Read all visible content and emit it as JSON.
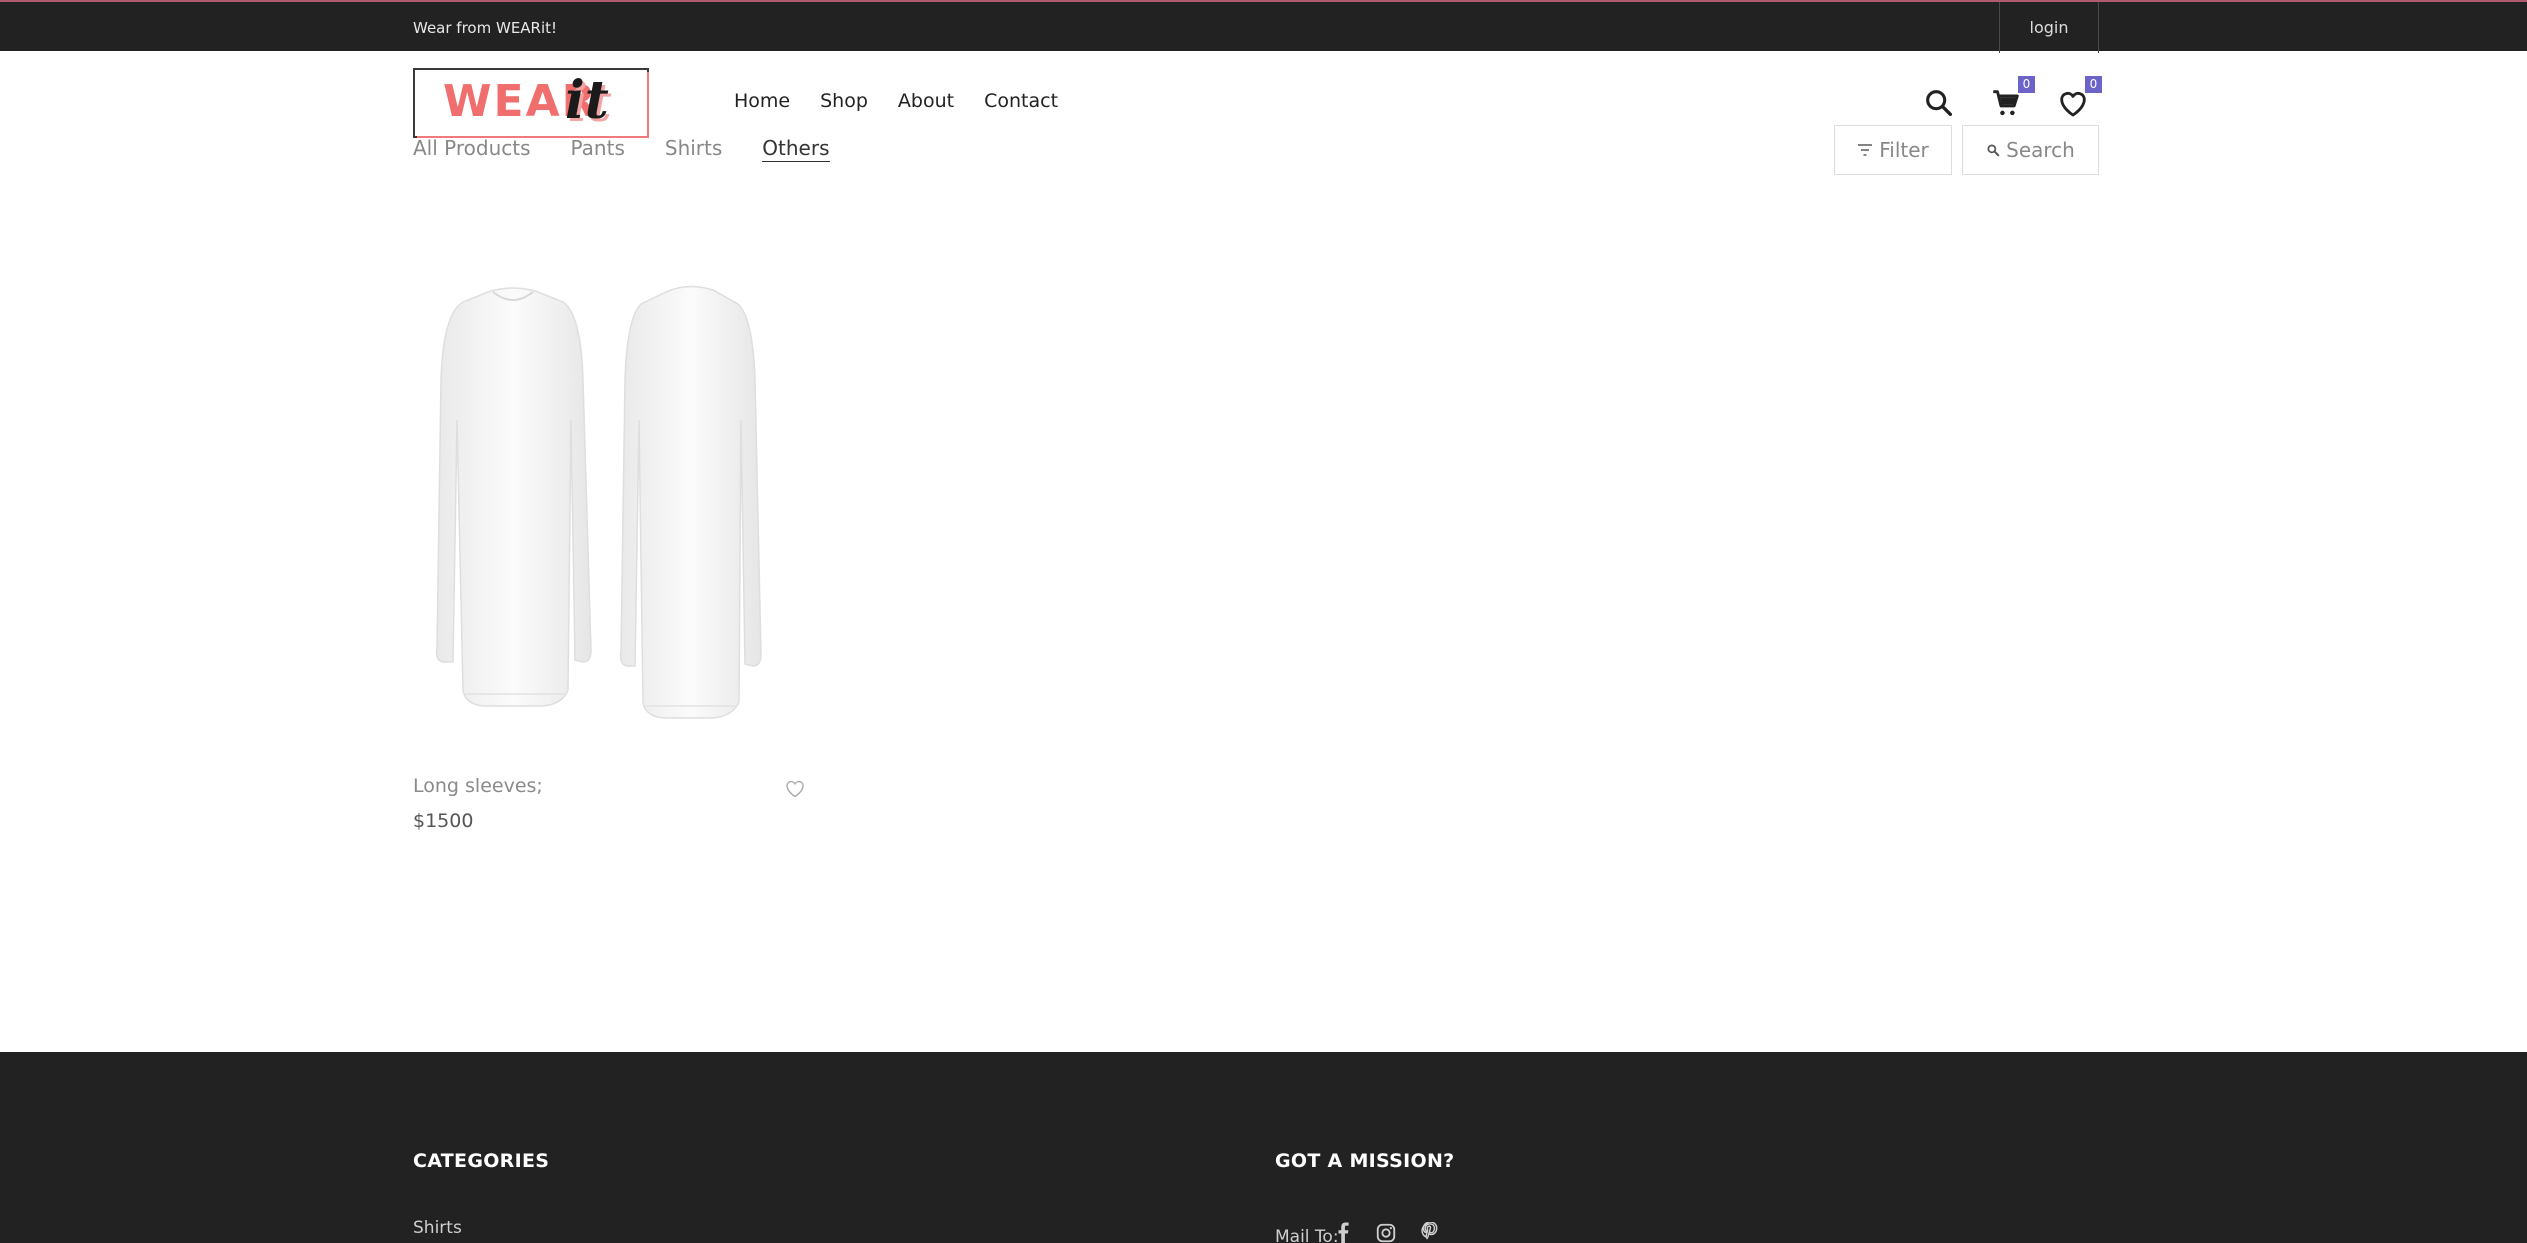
{
  "topbar": {
    "tagline": "Wear from WEARit!",
    "login_label": "login"
  },
  "logo": {
    "word": "WEAR",
    "suffix": "it"
  },
  "nav": {
    "items": [
      "Home",
      "Shop",
      "About",
      "Contact"
    ]
  },
  "header_icons": {
    "search": "search-icon",
    "cart": "cart-icon",
    "wishlist": "heart-icon",
    "cart_count": "0",
    "wishlist_count": "0"
  },
  "categories": {
    "tabs": [
      "All Products",
      "Pants",
      "Shirts",
      "Others"
    ],
    "active": "Others"
  },
  "tools": {
    "filter_label": "Filter",
    "search_label": "Search"
  },
  "products": [
    {
      "name": "Long sleeves;",
      "price": "$1500"
    }
  ],
  "footer": {
    "categories_title": "CATEGORIES",
    "categories_items": [
      "Shirts"
    ],
    "mission_title": "GOT A MISSION?",
    "mail_label": "Mail To:",
    "social": [
      "facebook-icon",
      "instagram-icon",
      "pinterest-icon"
    ]
  },
  "colors": {
    "topbar_bg": "#222222",
    "footer_bg": "#222222",
    "badge": "#6c63c8",
    "logo_accent": "#f06e6e"
  }
}
